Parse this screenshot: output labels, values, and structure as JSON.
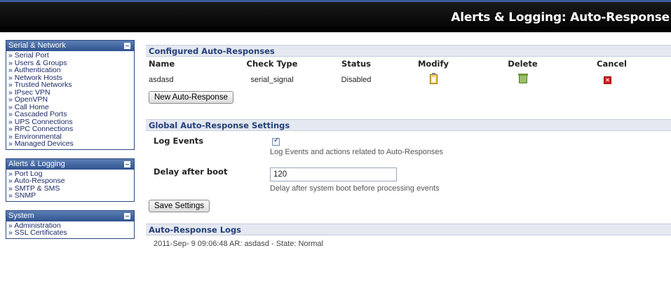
{
  "header": {
    "title": "Alerts & Logging: Auto-Response"
  },
  "sidebar": {
    "sections": [
      {
        "title": "Serial & Network",
        "items": [
          "Serial Port",
          "Users & Groups",
          "Authentication",
          "Network Hosts",
          "Trusted Networks",
          "IPsec VPN",
          "OpenVPN",
          "Call Home",
          "Cascaded Ports",
          "UPS Connections",
          "RPC Connections",
          "Environmental",
          "Managed Devices"
        ]
      },
      {
        "title": "Alerts & Logging",
        "items": [
          "Port Log",
          "Auto-Response",
          "SMTP & SMS",
          "SNMP"
        ]
      },
      {
        "title": "System",
        "items": [
          "Administration",
          "SSL Certificates"
        ]
      }
    ]
  },
  "configured": {
    "heading": "Configured Auto-Responses",
    "columns": [
      "Name",
      "Check Type",
      "Status",
      "Modify",
      "Delete",
      "Cancel"
    ],
    "rows": [
      {
        "name": "asdasd",
        "check_type": "serial_signal",
        "status": "Disabled"
      }
    ],
    "new_button": "New Auto-Response"
  },
  "global": {
    "heading": "Global Auto-Response Settings",
    "log_events": {
      "label": "Log Events",
      "checked": true,
      "description": "Log Events and actions related to Auto-Responses"
    },
    "delay": {
      "label": "Delay after boot",
      "value": "120",
      "description": "Delay after system boot before processing events"
    },
    "save_button": "Save Settings"
  },
  "logs": {
    "heading": "Auto-Response Logs",
    "entries": [
      "2011-Sep- 9 09:06:48 AR: asdasd - State: Normal"
    ]
  },
  "colors": {
    "accent": "#2f5390",
    "section_bg": "#e4e8f0",
    "section_text": "#24407a"
  }
}
